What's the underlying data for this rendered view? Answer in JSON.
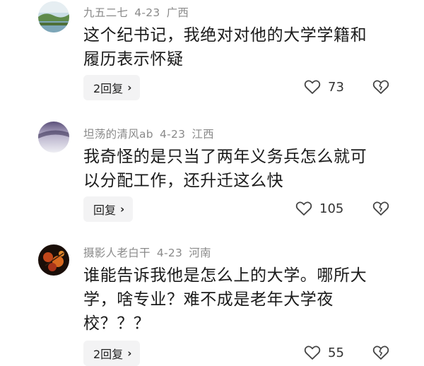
{
  "comments": [
    {
      "username": "九五二七",
      "date": "4-23",
      "location": "广西",
      "text_lines": [
        "这个纪书记，我绝对对他的大学学籍和",
        "履历表示怀疑"
      ],
      "reply_label": "2回复",
      "likes": "73",
      "avatar_icon": "landscape-avatar"
    },
    {
      "username": "坦荡的清风ab",
      "date": "4-23",
      "location": "江西",
      "text_lines": [
        "我奇怪的是只当了两年义务兵怎么就可",
        "以分配工作，还升迁这么快"
      ],
      "reply_label": "回复",
      "likes": "105",
      "avatar_icon": "purple-gradient-avatar"
    },
    {
      "username": "摄影人老白干",
      "date": "4-23",
      "location": "河南",
      "text_lines": [
        "谁能告诉我他是怎么上的大学。哪所大",
        "学，啥专业？难不成是老年大学夜",
        "校？？？"
      ],
      "reply_label": "2回复",
      "likes": "55",
      "avatar_icon": "autumn-leaves-avatar"
    }
  ],
  "icons": {
    "reply_chevron": "›",
    "like": "heart-outline-icon",
    "dislike": "broken-heart-icon"
  },
  "colors": {
    "meta_text": "#8a8a8a",
    "body_text": "#1a1a1a",
    "reply_bg": "#f3f3f4"
  }
}
